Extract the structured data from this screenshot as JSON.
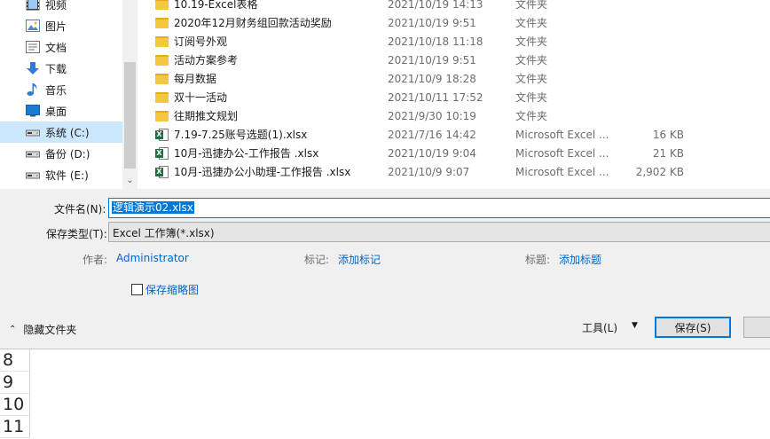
{
  "nav": {
    "items": [
      {
        "label": "视频",
        "icon": "video-icon"
      },
      {
        "label": "图片",
        "icon": "pictures-icon"
      },
      {
        "label": "文档",
        "icon": "documents-icon"
      },
      {
        "label": "下载",
        "icon": "download-icon"
      },
      {
        "label": "音乐",
        "icon": "music-icon"
      },
      {
        "label": "桌面",
        "icon": "desktop-icon"
      },
      {
        "label": "系统 (C:)",
        "icon": "drive-icon",
        "selected": true
      },
      {
        "label": "备份 (D:)",
        "icon": "drive-icon"
      },
      {
        "label": "软件 (E:)",
        "icon": "drive-icon"
      }
    ]
  },
  "files": [
    {
      "name": "10.19-Excel表格",
      "date": "2021/10/19 14:13",
      "type": "文件夹",
      "size": "",
      "kind": "folder"
    },
    {
      "name": "2020年12月财务组回款活动奖励",
      "date": "2021/10/19 9:51",
      "type": "文件夹",
      "size": "",
      "kind": "folder"
    },
    {
      "name": "订阅号外观",
      "date": "2021/10/18 11:18",
      "type": "文件夹",
      "size": "",
      "kind": "folder"
    },
    {
      "name": "活动方案参考",
      "date": "2021/10/19 9:51",
      "type": "文件夹",
      "size": "",
      "kind": "folder"
    },
    {
      "name": "每月数据",
      "date": "2021/10/9 18:28",
      "type": "文件夹",
      "size": "",
      "kind": "folder"
    },
    {
      "name": "双十一活动",
      "date": "2021/10/11 17:52",
      "type": "文件夹",
      "size": "",
      "kind": "folder"
    },
    {
      "name": "往期推文规划",
      "date": "2021/9/30 10:19",
      "type": "文件夹",
      "size": "",
      "kind": "folder"
    },
    {
      "name": "7.19-7.25账号选题(1).xlsx",
      "date": "2021/7/16 14:42",
      "type": "Microsoft Excel ...",
      "size": "16 KB",
      "kind": "excel"
    },
    {
      "name": "10月-迅捷办公-工作报告   .xlsx",
      "date": "2021/10/19 9:04",
      "type": "Microsoft Excel ...",
      "size": "21 KB",
      "kind": "excel"
    },
    {
      "name": "10月-迅捷办公小助理-工作报告 .xlsx",
      "date": "2021/10/9 9:07",
      "type": "Microsoft Excel ...",
      "size": "2,902 KB",
      "kind": "excel"
    }
  ],
  "dialog": {
    "filename_label": "文件名(N):",
    "filename_value": "逻辑演示02.xlsx",
    "filetype_label": "保存类型(T):",
    "filetype_value": "Excel 工作簿(*.xlsx)",
    "author_label": "作者:",
    "author_value": "Administrator",
    "tags_label": "标记:",
    "tags_value": "添加标记",
    "title_label": "标题:",
    "title_value": "添加标题",
    "thumbnail_label": "保存缩略图",
    "hide_folders_label": "隐藏文件夹",
    "tools_label": "工具(L)",
    "save_label": "保存(S)"
  },
  "sheet": {
    "rows": [
      "8",
      "9",
      "10",
      "11"
    ]
  }
}
